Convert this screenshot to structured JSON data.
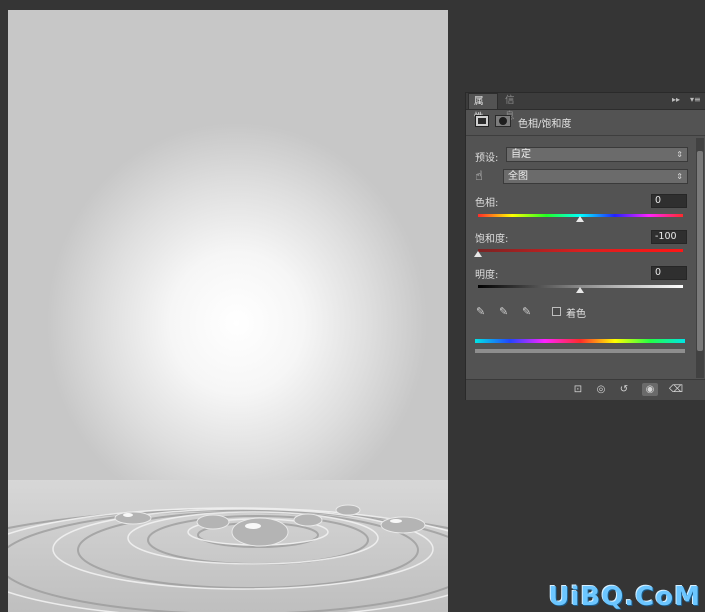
{
  "panel": {
    "tabs": [
      "属性",
      "信息"
    ],
    "header_title": "色相/饱和度",
    "preset_label": "预设:",
    "preset_value": "自定",
    "channel_value": "全图",
    "hue": {
      "label": "色相:",
      "value": "0"
    },
    "saturation": {
      "label": "饱和度:",
      "value": "-100"
    },
    "lightness": {
      "label": "明度:",
      "value": "0"
    },
    "colorize_label": "着色",
    "colorize_checked": false
  },
  "icons": {
    "expand": "double-arrow-icon",
    "menu": "panel-menu-icon",
    "hand": "targeted-adjustment-hand-icon",
    "eyedroppers": [
      "eyedropper-icon",
      "eyedropper-plus-icon",
      "eyedropper-minus-icon"
    ],
    "footer": [
      "clip-to-layer-icon",
      "view-previous-icon",
      "reset-icon",
      "visibility-eye-icon",
      "trash-icon"
    ]
  },
  "watermark": "UiBQ.CoM",
  "colors": {
    "background": "#353535",
    "panel": "#535353",
    "spectrum": [
      "#ff2020",
      "#ffff00",
      "#00ff00",
      "#00ffff",
      "#0000ff",
      "#ff00ff",
      "#ff2020"
    ]
  }
}
